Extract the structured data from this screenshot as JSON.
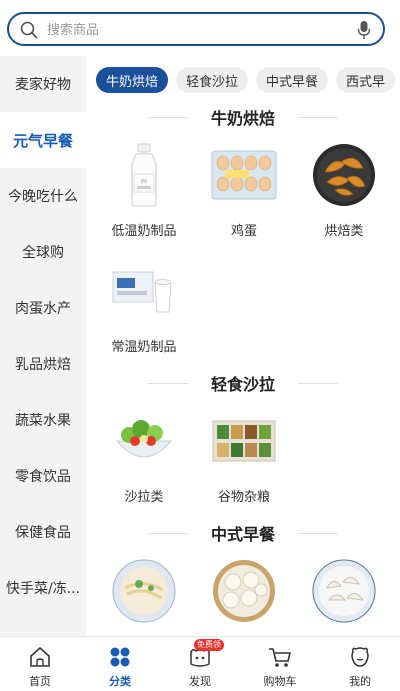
{
  "search": {
    "placeholder": "搜索商品"
  },
  "sidebar": {
    "items": [
      {
        "label": "麦家好物"
      },
      {
        "label": "元气早餐"
      },
      {
        "label": "今晚吃什么"
      },
      {
        "label": "全球购"
      },
      {
        "label": "肉蛋水产"
      },
      {
        "label": "乳品烘焙"
      },
      {
        "label": "蔬菜水果"
      },
      {
        "label": "零食饮品"
      },
      {
        "label": "保健食品"
      },
      {
        "label": "快手菜/冻..."
      }
    ],
    "active_index": 1
  },
  "tabs": [
    {
      "label": "牛奶烘焙"
    },
    {
      "label": "轻食沙拉"
    },
    {
      "label": "中式早餐"
    },
    {
      "label": "西式早"
    }
  ],
  "sections": [
    {
      "title": "牛奶烘焙",
      "items": [
        {
          "label": "低温奶制品",
          "icon": "milk-bottle-icon"
        },
        {
          "label": "鸡蛋",
          "icon": "egg-tray-icon"
        },
        {
          "label": "烘焙类",
          "icon": "croissant-icon"
        },
        {
          "label": "常温奶制品",
          "icon": "milk-carton-icon"
        }
      ]
    },
    {
      "title": "轻食沙拉",
      "items": [
        {
          "label": "沙拉类",
          "icon": "salad-bowl-icon"
        },
        {
          "label": "谷物杂粮",
          "icon": "grain-box-icon"
        }
      ]
    },
    {
      "title": "中式早餐",
      "items": [
        {
          "label": "",
          "icon": "noodle-plate-icon"
        },
        {
          "label": "",
          "icon": "bun-steamer-icon"
        },
        {
          "label": "",
          "icon": "dumpling-plate-icon"
        }
      ]
    }
  ],
  "bottom_nav": {
    "items": [
      {
        "label": "首页",
        "icon": "home-icon"
      },
      {
        "label": "分类",
        "icon": "category-icon"
      },
      {
        "label": "发现",
        "icon": "discover-icon",
        "badge": "免费领"
      },
      {
        "label": "购物车",
        "icon": "cart-icon"
      },
      {
        "label": "我的",
        "icon": "profile-icon"
      }
    ],
    "active_index": 1
  },
  "colors": {
    "accent": "#1a4f9c",
    "accent_text": "#1a5bb5",
    "badge": "#e8322b",
    "sidebar_bg": "#f3f3f3"
  }
}
